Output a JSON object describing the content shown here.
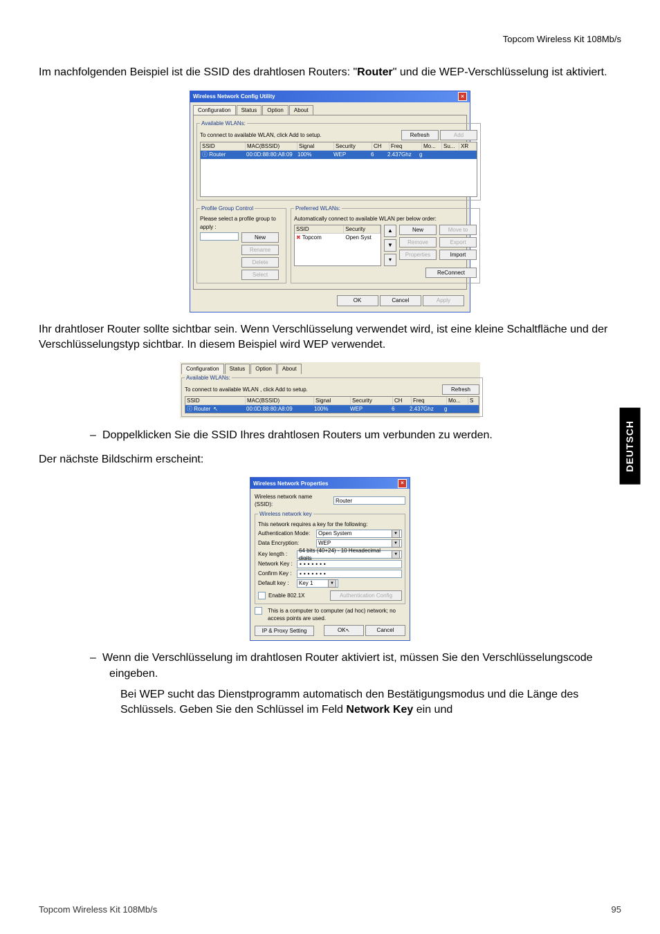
{
  "header": {
    "product": "Topcom Wireless Kit 108Mb/s"
  },
  "side_tab": "DEUTSCH",
  "footer": {
    "left": "Topcom Wireless Kit 108Mb/s",
    "page": "95"
  },
  "body": {
    "p1_pre": "Im nachfolgenden Beispiel ist die SSID des drahtlosen Routers: \"",
    "p1_bold": "Router",
    "p1_post": "\" und die WEP-Verschlüsselung ist aktiviert.",
    "p2": "Ihr drahtloser Router sollte sichtbar sein. Wenn Verschlüsselung verwendet wird, ist eine kleine Schaltfläche und der Verschlüsselungstyp sichtbar. In diesem Beispiel wird WEP verwendet.",
    "li1": "Doppelklicken Sie die SSID Ihres drahtlosen Routers um verbunden zu werden.",
    "p3": "Der nächste Bildschirm erscheint:",
    "li2a": "Wenn die Verschlüsselung im drahtlosen Router aktiviert ist, müssen Sie den Verschlüsselungscode eingeben.",
    "li2b_pre": "Bei WEP sucht das Dienstprogramm automatisch den Bestätigungsmodus und die Länge des Schlüssels. Geben Sie den Schlüssel im Feld ",
    "li2b_bold": "Network Key",
    "li2b_post": " ein und"
  },
  "fig1": {
    "title": "Wireless Network Config Utility",
    "tabs": [
      "Configuration",
      "Status",
      "Option",
      "About"
    ],
    "grp_available": "Available WLANs:",
    "available_hint": "To connect to available WLAN, click Add to setup.",
    "btn_refresh": "Refresh",
    "btn_add": "Add",
    "cols": [
      "SSID",
      "MAC(BSSID)",
      "Signal",
      "Security",
      "CH",
      "Freq",
      "Mo...",
      "Su...",
      "XR"
    ],
    "row": {
      "ssid": "Router",
      "mac": "00:0D:88:80:A8:09",
      "signal": "100%",
      "security": "WEP",
      "ch": "6",
      "freq": "2.437Ghz",
      "mode": "g",
      "su": "",
      "xr": ""
    },
    "grp_profile": "Profile Group Control",
    "profile_hint": "Please select a profile group to apply :",
    "p_new": "New",
    "p_rename": "Rename",
    "p_delete": "Delete",
    "p_select": "Select",
    "grp_pref": "Preferred WLANs:",
    "pref_hint": "Automatically connect to available WLAN per below order:",
    "pref_cols": [
      "SSID",
      "Security"
    ],
    "pref_row": {
      "ssid": "Topcom",
      "security": "Open Syst"
    },
    "pf_new": "New",
    "pf_remove": "Remove",
    "pf_properties": "Properties",
    "pf_moveto": "Move to",
    "pf_export": "Export",
    "pf_import": "Import",
    "pf_reconnect": "ReConnect",
    "ok": "OK",
    "cancel": "Cancel",
    "apply": "Apply"
  },
  "fig2": {
    "tabs": [
      "Configuration",
      "Status",
      "Option",
      "About"
    ],
    "grp_available": "Available WLANs:",
    "available_hint": "To connect to available WLAN , click Add to setup.",
    "btn_refresh": "Refresh",
    "cols": [
      "SSID",
      "MAC(BSSID)",
      "Signal",
      "Security",
      "CH",
      "Freq",
      "Mo...",
      "S"
    ],
    "row": {
      "ssid": "Router",
      "mac": "00:0D:88:80:A8:09",
      "signal": "100%",
      "security": "WEP",
      "ch": "6",
      "freq": "2.437Ghz",
      "mode": "g",
      "s": ""
    }
  },
  "fig3": {
    "title": "Wireless Network Properties",
    "ssid_lbl": "Wireless network name (SSID):",
    "ssid_val": "Router",
    "grp_key": "Wireless network key",
    "key_hint": "This network requires a key for the following:",
    "auth_lbl": "Authentication Mode:",
    "auth_val": "Open System",
    "enc_lbl": "Data Encryption:",
    "enc_val": "WEP",
    "keylen_lbl": "Key length :",
    "keylen_val": "64 bits (40+24) - 10 Hexadecimal digits",
    "netkey_lbl": "Network Key :",
    "netkey_val": "•••••••",
    "conf_lbl": "Confirm Key :",
    "conf_val": "•••••••",
    "defkey_lbl": "Default key :",
    "defkey_val": "Key 1",
    "enable8021x": "Enable 802.1X",
    "authconf": "Authentication Config",
    "adhoc": "This is a computer to computer (ad hoc) network; no access points are used.",
    "ipproxy": "IP & Proxy Setting",
    "ok": "OK",
    "cancel": "Cancel"
  }
}
